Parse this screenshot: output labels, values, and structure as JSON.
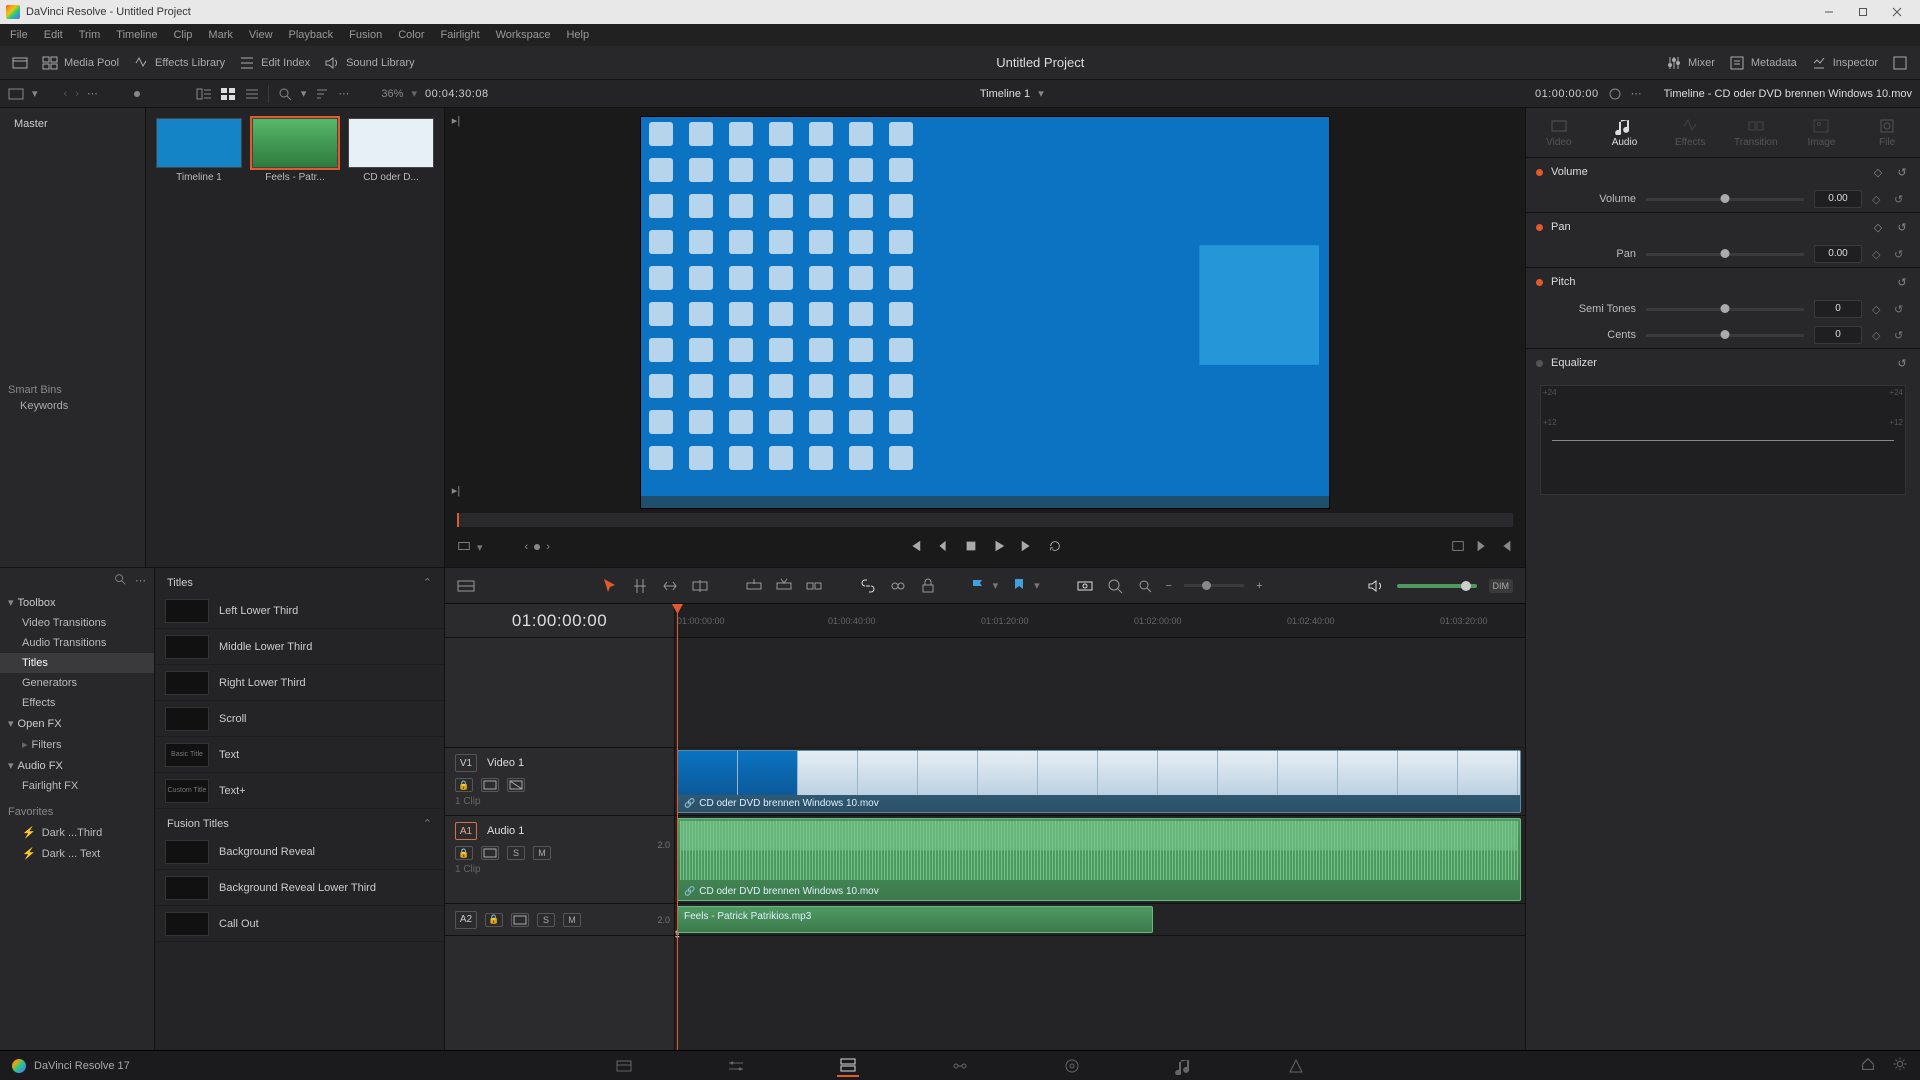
{
  "window": {
    "title": "DaVinci Resolve - Untitled Project"
  },
  "menu": [
    "File",
    "Edit",
    "Trim",
    "Timeline",
    "Clip",
    "Mark",
    "View",
    "Playback",
    "Fusion",
    "Color",
    "Fairlight",
    "Workspace",
    "Help"
  ],
  "workspace": {
    "left": [
      {
        "id": "media-pool",
        "label": "Media Pool"
      },
      {
        "id": "effects-library",
        "label": "Effects Library"
      },
      {
        "id": "edit-index",
        "label": "Edit Index"
      },
      {
        "id": "sound-library",
        "label": "Sound Library"
      }
    ],
    "right": [
      {
        "id": "mixer",
        "label": "Mixer"
      },
      {
        "id": "metadata",
        "label": "Metadata"
      },
      {
        "id": "inspector",
        "label": "Inspector"
      }
    ],
    "project_title": "Untitled Project"
  },
  "secbar": {
    "zoom_pct": "36%",
    "src_timecode": "00:04:30:08",
    "timeline_name": "Timeline 1",
    "record_timecode": "01:00:00:00"
  },
  "media": {
    "master_label": "Master",
    "smart_bins_label": "Smart Bins",
    "keywords_label": "Keywords",
    "thumbs": [
      {
        "label": "Timeline 1",
        "kind": "blue"
      },
      {
        "label": "Feels - Patr...",
        "kind": "green",
        "selected": true
      },
      {
        "label": "CD oder D...",
        "kind": "win"
      }
    ]
  },
  "effects": {
    "tree": {
      "search_placeholder": "",
      "toolbox": "Toolbox",
      "categories": [
        "Video Transitions",
        "Audio Transitions",
        "Titles",
        "Generators",
        "Effects"
      ],
      "openfx": "Open FX",
      "filters": "Filters",
      "audiofx": "Audio FX",
      "fairlight": "Fairlight FX",
      "favorites": "Favorites",
      "fav_items": [
        "Dark ...Third",
        "Dark ... Text"
      ]
    },
    "list": {
      "titles_header": "Titles",
      "titles": [
        "Left Lower Third",
        "Middle Lower Third",
        "Right Lower Third",
        "Scroll",
        "Text",
        "Text+"
      ],
      "fusion_header": "Fusion Titles",
      "fusion": [
        "Background Reveal",
        "Background Reveal Lower Third",
        "Call Out"
      ]
    }
  },
  "timeline": {
    "playhead_tc": "01:00:00:00",
    "ruler_ticks": [
      "01:00:00:00",
      "01:00:40:00",
      "01:01:20:00",
      "01:02:00:00",
      "01:02:40:00",
      "01:03:20:00"
    ],
    "v1": {
      "badge": "V1",
      "name": "Video 1",
      "clips_label": "1 Clip",
      "clip_label": "CD oder DVD brennen Windows 10.mov"
    },
    "a1": {
      "badge": "A1",
      "name": "Audio 1",
      "channels": "2.0",
      "clips_label": "1 Clip",
      "clip_label": "CD oder DVD brennen Windows 10.mov"
    },
    "a2": {
      "badge": "A2",
      "channels": "2.0",
      "clip_label": "Feels - Patrick Patrikios.mp3"
    },
    "dim_label": "DIM"
  },
  "inspector": {
    "clip_title": "Timeline - CD oder DVD brennen Windows 10.mov",
    "tabs": [
      "Video",
      "Audio",
      "Effects",
      "Transition",
      "Image",
      "File"
    ],
    "active_tab": 1,
    "volume": {
      "header": "Volume",
      "row_label": "Volume",
      "value": "0.00"
    },
    "pan": {
      "header": "Pan",
      "row_label": "Pan",
      "value": "0.00"
    },
    "pitch": {
      "header": "Pitch",
      "semi_label": "Semi Tones",
      "semi_value": "0",
      "cents_label": "Cents",
      "cents_value": "0"
    },
    "eq": {
      "header": "Equalizer",
      "labels_left": [
        "+24",
        "+12"
      ],
      "labels_right": [
        "+24",
        "+12"
      ]
    }
  },
  "footer": {
    "brand": "DaVinci Resolve 17"
  }
}
